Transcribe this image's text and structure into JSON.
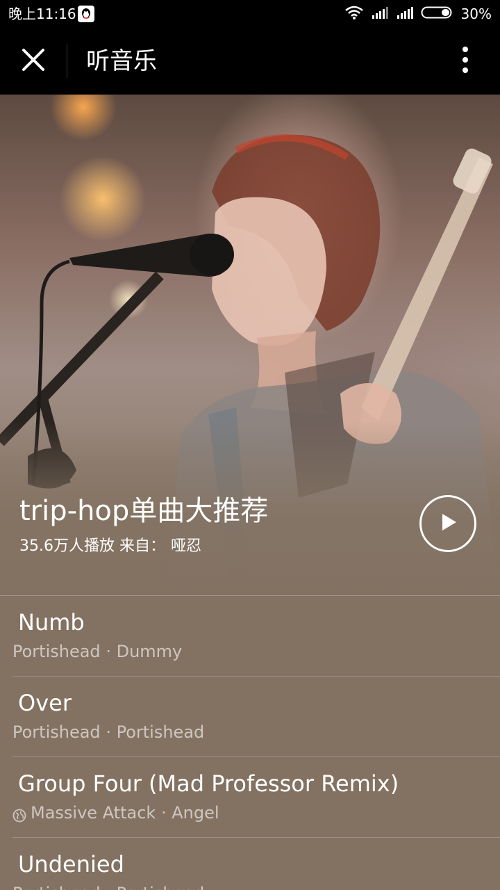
{
  "status_bar": {
    "time": "晚上11:16",
    "battery": "30%",
    "icons": [
      "qq-icon",
      "wifi-icon",
      "signal-icon",
      "signal-icon",
      "battery-icon"
    ]
  },
  "app_bar": {
    "close_icon": "close-icon",
    "title": "听音乐",
    "more_icon": "more-vertical-icon"
  },
  "playlist": {
    "title": "trip-hop单曲大推荐",
    "plays": "35.6万人播放",
    "from_label": "来自：",
    "author": "哑忍",
    "play_icon": "play-icon"
  },
  "tracks": [
    {
      "title": "Numb",
      "artist": "Portishead",
      "separator": "·",
      "album": "Dummy",
      "icon": ""
    },
    {
      "title": "Over",
      "artist": "Portishead",
      "separator": "·",
      "album": "Portishead",
      "icon": ""
    },
    {
      "title": "Group Four (Mad Professor Remix)",
      "artist": "Massive Attack",
      "separator": "·",
      "album": "Angel",
      "icon": "globe-icon"
    },
    {
      "title": "Undenied",
      "artist": "Portishead",
      "separator": "·",
      "album": "Portishead",
      "icon": ""
    }
  ],
  "colors": {
    "background": "#837262",
    "bar": "#000000",
    "text": "#ffffff"
  }
}
